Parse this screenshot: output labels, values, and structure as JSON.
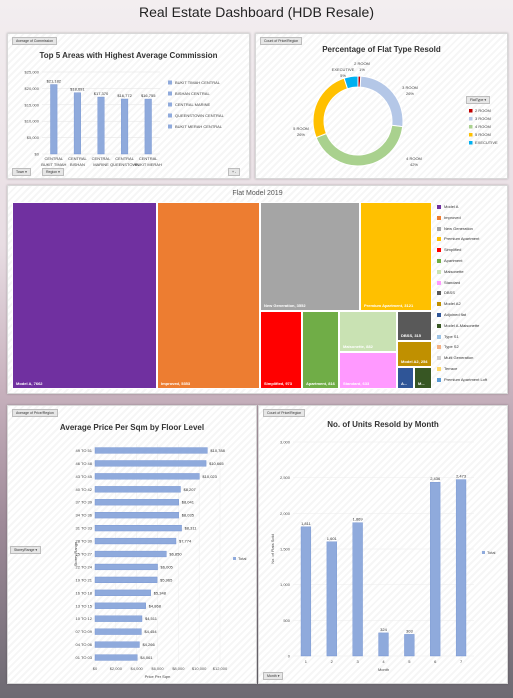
{
  "page": {
    "title": "Real Estate Dashboard (HDB Resale)"
  },
  "panels": {
    "top5": {
      "field_pill": "Average of Commission",
      "filter_town": "Town",
      "filter_region": "Region"
    },
    "flat_type": {
      "field_pill": "Count of Price/Region",
      "legend_title": "FlatType"
    },
    "flat_model": {},
    "price_sqm": {
      "field_pill": "Average of Price/Region",
      "filter": "StoreyRange"
    },
    "units_month": {
      "field_pill": "Count of Price/Region",
      "filter": "Month"
    }
  },
  "colors": {
    "bar": "#8faadc",
    "bar_line": "#6f8fcf",
    "model_a": "#7030a0"
  },
  "chart_data": [
    {
      "id": "top5",
      "type": "bar",
      "title": "Top 5 Areas with Highest Average Commission",
      "categories": [
        "CENTRAL BUKIT TIMAH",
        "CENTRAL BISHAN",
        "CENTRAL MARINE",
        "CENTRAL QUEENSTOWN",
        "CENTRAL BUKIT MERAH"
      ],
      "category_lines": [
        [
          "CENTRAL",
          "BUKIT TIMAH"
        ],
        [
          "CENTRAL",
          "BISHAN"
        ],
        [
          "CENTRAL",
          "MARINE"
        ],
        [
          "CENTRAL",
          "QUEENSTOWN"
        ],
        [
          "CENTRAL",
          "BUKIT MERAH"
        ]
      ],
      "values": [
        21182,
        18691,
        17370,
        16772,
        16755
      ],
      "value_labels": [
        "$21,182",
        "$18,691",
        "$17,370",
        "$16,772",
        "$16,755"
      ],
      "ylim": [
        0,
        25000
      ],
      "yticks": [
        "$0",
        "$5,000",
        "$10,000",
        "$15,000",
        "$20,000",
        "$25,000"
      ],
      "legend": [
        "BUKIT TIMAH CENTRAL",
        "BISHAN CENTRAL",
        "CENTRAL MARINE",
        "QUEENSTOWN CENTRAL",
        "BUKIT MERAH CENTRAL"
      ]
    },
    {
      "id": "flat_type",
      "type": "pie",
      "title": "Percentage of Flat Type Resold",
      "slices": [
        {
          "name": "2 ROOM",
          "value": 1,
          "label_lines": [
            "2 ROOM",
            "1%"
          ],
          "color": "#c00000"
        },
        {
          "name": "3 ROOM",
          "value": 26,
          "label_lines": [
            "3 ROOM",
            "26%"
          ],
          "color": "#b4c7e7"
        },
        {
          "name": "4 ROOM",
          "value": 42,
          "label_lines": [
            "4 ROOM",
            "42%"
          ],
          "color": "#a9d18e"
        },
        {
          "name": "5 ROOM",
          "value": 26,
          "label_lines": [
            "5 ROOM",
            "26%"
          ],
          "color": "#ffc000"
        },
        {
          "name": "EXECUTIVE",
          "value": 5,
          "label_lines": [
            "EXECUTIVE",
            "5%"
          ],
          "color": "#00b0f0"
        }
      ],
      "legend": [
        "2 ROOM",
        "3 ROOM",
        "4 ROOM",
        "5 ROOM",
        "EXECUTIVE"
      ]
    },
    {
      "id": "flat_model",
      "type": "treemap",
      "title": "Flat Model 2019",
      "items": [
        {
          "name": "Model A",
          "label": "Model A, 7662",
          "color": "#7030a0"
        },
        {
          "name": "Improved",
          "label": "Improved, 5353",
          "color": "#ed7d31"
        },
        {
          "name": "New Generation",
          "label": "New Generation, 3552",
          "color": "#a5a5a5"
        },
        {
          "name": "Premium Apartment",
          "label": "Premium Apartment, 3121",
          "color": "#ffc000"
        },
        {
          "name": "Simplified",
          "label": "Simplified, 973",
          "color": "#ff0000"
        },
        {
          "name": "Apartment",
          "label": "Apartment, 816",
          "color": "#70ad47"
        },
        {
          "name": "Maisonette",
          "label": "Maisonette, 882",
          "color": "#c9e2b3"
        },
        {
          "name": "Standard",
          "label": "Standard, 633",
          "color": "#ff99ff"
        },
        {
          "name": "DBSS",
          "label": "DBSS, 315",
          "color": "#595959"
        },
        {
          "name": "Model A2",
          "label": "Model A2, 254",
          "color": "#c09000"
        },
        {
          "name": "Adjoined flat",
          "label": "A...",
          "color": "#2f5597"
        },
        {
          "name": "Model A-Maisonette",
          "label": "M...",
          "color": "#375623"
        }
      ],
      "legend": [
        {
          "name": "Model A",
          "color": "#7030a0"
        },
        {
          "name": "Improved",
          "color": "#ed7d31"
        },
        {
          "name": "New Generation",
          "color": "#a5a5a5"
        },
        {
          "name": "Premium Apartment",
          "color": "#ffc000"
        },
        {
          "name": "Simplified",
          "color": "#ff0000"
        },
        {
          "name": "Apartment",
          "color": "#70ad47"
        },
        {
          "name": "Maisonette",
          "color": "#c9e2b3"
        },
        {
          "name": "Standard",
          "color": "#ff99ff"
        },
        {
          "name": "DBSS",
          "color": "#595959"
        },
        {
          "name": "Model A2",
          "color": "#c09000"
        },
        {
          "name": "Adjoined flat",
          "color": "#2f5597"
        },
        {
          "name": "Model A-Maisonette",
          "color": "#375623"
        },
        {
          "name": "Type S1",
          "color": "#9dc3e6"
        },
        {
          "name": "Type S2",
          "color": "#f4b183"
        },
        {
          "name": "Multi Generation",
          "color": "#d0cece"
        },
        {
          "name": "Terrace",
          "color": "#ffd966"
        },
        {
          "name": "Premium Apartment Loft",
          "color": "#5b9bd5"
        }
      ]
    },
    {
      "id": "price_sqm",
      "type": "bar",
      "orientation": "horizontal",
      "title": "Average Price Per Sqm by Floor Level",
      "categories": [
        "49 TO 51",
        "46 TO 48",
        "43 TO 45",
        "40 TO 42",
        "37 TO 39",
        "34 TO 36",
        "31 TO 33",
        "28 TO 30",
        "25 TO 27",
        "22 TO 24",
        "19 TO 21",
        "16 TO 18",
        "13 TO 15",
        "10 TO 12",
        "07 TO 09",
        "04 TO 06",
        "01 TO 03"
      ],
      "values": [
        10788,
        10665,
        10023,
        8207,
        8041,
        8035,
        8311,
        7774,
        6850,
        6005,
        5965,
        5348,
        4868,
        4511,
        4454,
        4266,
        4061
      ],
      "value_labels": [
        "$10,788",
        "$10,665",
        "$10,023",
        "$8,207",
        "$8,041",
        "$8,035",
        "$8,311",
        "$7,774",
        "$6,850",
        "$6,005",
        "$5,965",
        "$5,348",
        "$4,868",
        "$4,511",
        "$4,454",
        "$4,266",
        "$4,061"
      ],
      "xlim": [
        0,
        12000
      ],
      "xticks": [
        "$0",
        "$2,000",
        "$4,000",
        "$6,000",
        "$8,000",
        "$10,000",
        "$12,000"
      ],
      "xlabel": "Price Per Sqm",
      "ylabel": "Storey Range",
      "legend": [
        "Total"
      ]
    },
    {
      "id": "units_month",
      "type": "bar",
      "title": "No. of Units Resold by Month",
      "categories": [
        "1",
        "2",
        "3",
        "4",
        "5",
        "6",
        "7"
      ],
      "values": [
        1811,
        1601,
        1869,
        324,
        303,
        2436,
        2473
      ],
      "value_labels": [
        "1,811",
        "1,601",
        "1,869",
        "324",
        "303",
        "2,436",
        "2,473"
      ],
      "ylim": [
        0,
        3000
      ],
      "yticks": [
        "0",
        "500",
        "1,000",
        "1,500",
        "2,000",
        "2,500",
        "3,000"
      ],
      "xlabel": "Month",
      "ylabel": "No. of Flats Sold",
      "legend": [
        "Total"
      ]
    }
  ]
}
